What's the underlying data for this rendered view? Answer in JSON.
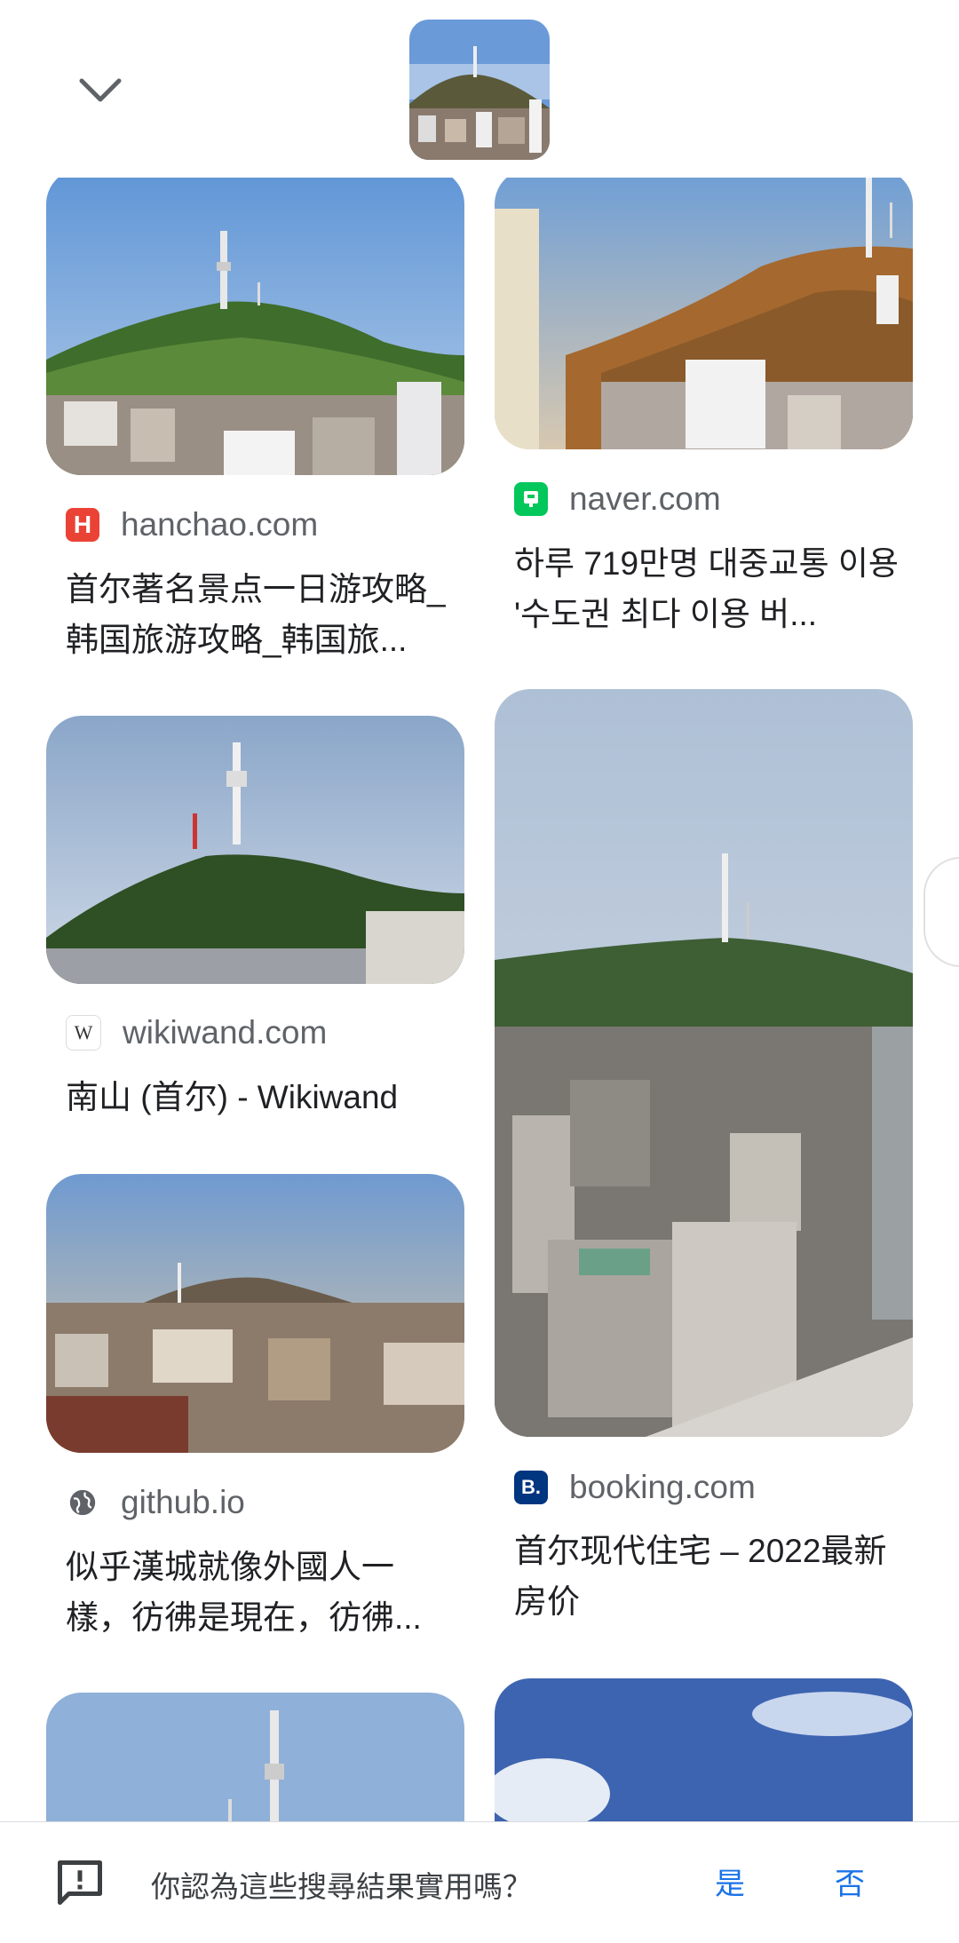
{
  "header": {
    "collapse_icon": "chevron-down-icon",
    "query_image_icon": "namsan-tower-thumbnail"
  },
  "results": [
    {
      "source": "hanchao.com",
      "favicon_letter": "H",
      "favicon_color": "#ea4335",
      "title": "首尔著名景点一日游攻略_韩国旅游攻略_韩国旅..."
    },
    {
      "source": "naver.com",
      "favicon_letter": "",
      "favicon_color": "#03c75a",
      "title": "하루 719만명 대중교통 이용 '수도권 최다 이용 버..."
    },
    {
      "source": "wikiwand.com",
      "favicon_letter": "W",
      "favicon_color": "#ffffff",
      "title": "南山 (首尔) - Wikiwand"
    },
    {
      "source": "booking.com",
      "favicon_letter": "B.",
      "favicon_color": "#003580",
      "title": "首尔现代住宅 – 2022最新房价"
    },
    {
      "source": "github.io",
      "favicon_letter": "",
      "favicon_color": "#5f6368",
      "title": "似乎漢城就像外國人一樣，彷彿是現在，彷彿..."
    }
  ],
  "feedback": {
    "question": "你認為這些搜尋結果實用嗎？",
    "yes": "是",
    "no": "否",
    "icon": "feedback-icon"
  },
  "colors": {
    "link_blue": "#1a73e8",
    "text_gray": "#5f6368"
  }
}
